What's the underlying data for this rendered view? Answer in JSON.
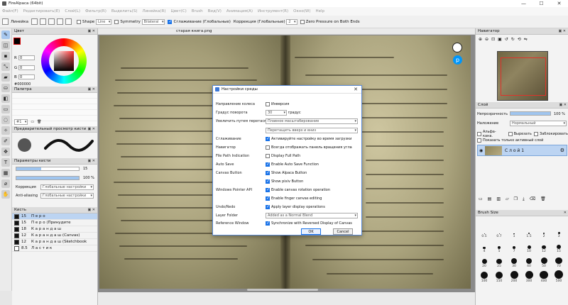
{
  "window": {
    "title": "FireAlpaca (64bit)",
    "minimize": "—",
    "maximize": "☐",
    "close": "✕"
  },
  "menu": [
    "Файл(F)",
    "Редактировать(E)",
    "Слой(L)",
    "Фильтр(R)",
    "Выделить(S)",
    "Линейка(R)",
    "Цвет(C)",
    "Brush",
    "Вид(V)",
    "Анимация(A)",
    "Инструмент(R)",
    "Окно(W)",
    "Help"
  ],
  "toolbar": {
    "ruler_label": "Линейка",
    "shape_label": "Shape",
    "shape_value": "Line",
    "symmetry_label": "Symmetry",
    "symmetry_value": "Bilateral",
    "smoothing_label": "Сглаживание (Глобальные)",
    "correction_label": "Коррекция (Глобальные)",
    "correction_value": "2",
    "zero_pressure_label": "Zero Pressure on Both Ends"
  },
  "left_panel": {
    "color_title": "Цвет",
    "color_r": "0",
    "color_g": "0",
    "color_b": "0",
    "hex": "#000000",
    "palette_title": "Палитра",
    "palette_count": "#1",
    "brush_preview_title": "Предварительный просмотр кисти",
    "brush_params_title": "Параметры кисти",
    "brush_size": "15",
    "brush_opacity": "100 %",
    "correction_label": "Коррекция",
    "correction_value": "Глобальные настройки",
    "antialias_label": "Anti-aliasing",
    "antialias_value": "Глобальные настройки",
    "brush_list_title": "Кисть",
    "brushes": [
      {
        "size": "15",
        "name": "П е р о"
      },
      {
        "size": "15",
        "name": "П е р о (Принудите"
      },
      {
        "size": "18",
        "name": "К а р а н д а ш"
      },
      {
        "size": "12",
        "name": "К а р а н д а ш (Canvas)"
      },
      {
        "size": "12",
        "name": "К а р а н д а ш (Sketchbook"
      },
      {
        "size": "8.5",
        "name": "Л а с т и к"
      }
    ]
  },
  "canvas": {
    "doc_name": "старая книга.png"
  },
  "dialog": {
    "title": "Настройки среды",
    "rows": [
      {
        "label": "Направление колеса",
        "checked": false,
        "text": "Инверсия"
      },
      {
        "label": "Градус поворота",
        "value": "30",
        "text": "градус"
      },
      {
        "label": "Увеличить путем перетаскивания",
        "value": "Плавное масштабирование"
      },
      {
        "label": "",
        "value": "Перетащить вверх и вниз"
      },
      {
        "label": "Сглаживание",
        "checked": true,
        "text": "Активируйте настройку во время загрузки"
      },
      {
        "label": "Навигатор",
        "checked": false,
        "text": "Всегда отображать панель вращения угла"
      },
      {
        "label": "File Path Indication",
        "checked": false,
        "text": "Display Full Path"
      },
      {
        "label": "Auto Save",
        "checked": true,
        "text": "Enable Auto Save Function"
      },
      {
        "label": "Canvas Button",
        "checked": true,
        "text": "Show Alpaca Button"
      },
      {
        "label": "",
        "checked": true,
        "text": "Show pixiv Button"
      },
      {
        "label": "Windows Pointer API",
        "checked": true,
        "text": "Enable canvas rotation operation"
      },
      {
        "label": "",
        "checked": true,
        "text": "Enable finger canvas editing"
      },
      {
        "label": "Undo/Redo",
        "checked": true,
        "text": "Apply layer display operations"
      },
      {
        "label": "Layer Folder",
        "value": "Added as a Normal Blend"
      },
      {
        "label": "Reference Window",
        "checked": true,
        "text": "Synchronize with Reversed Display of Canvas"
      }
    ],
    "ok": "OK",
    "cancel": "Cancel"
  },
  "right_panel": {
    "navigator_title": "Навигатор",
    "layer_title": "Слой",
    "opacity_label": "Непрозрачность",
    "opacity_value": "100 %",
    "blend_label": "Наложение",
    "blend_value": "Нормальный",
    "alpha_label": "Альфа-кана.",
    "clip_label": "Вырезать",
    "lock_label": "Заблокировать",
    "show_active_label": "Показать только активный слой",
    "layer_name": "С л о й 1",
    "brush_size_title": "Brush Size",
    "brush_sizes": [
      "0.5",
      "0.7",
      "1",
      "1.5",
      "2",
      "3",
      "4",
      "5",
      "7",
      "10",
      "12",
      "15",
      "20",
      "25",
      "30",
      "40",
      "50",
      "70",
      "100",
      "150",
      "200",
      "300",
      "400",
      "500"
    ]
  },
  "colors": {
    "accent": "#1a73e8",
    "selected": "#bcd4f2"
  }
}
